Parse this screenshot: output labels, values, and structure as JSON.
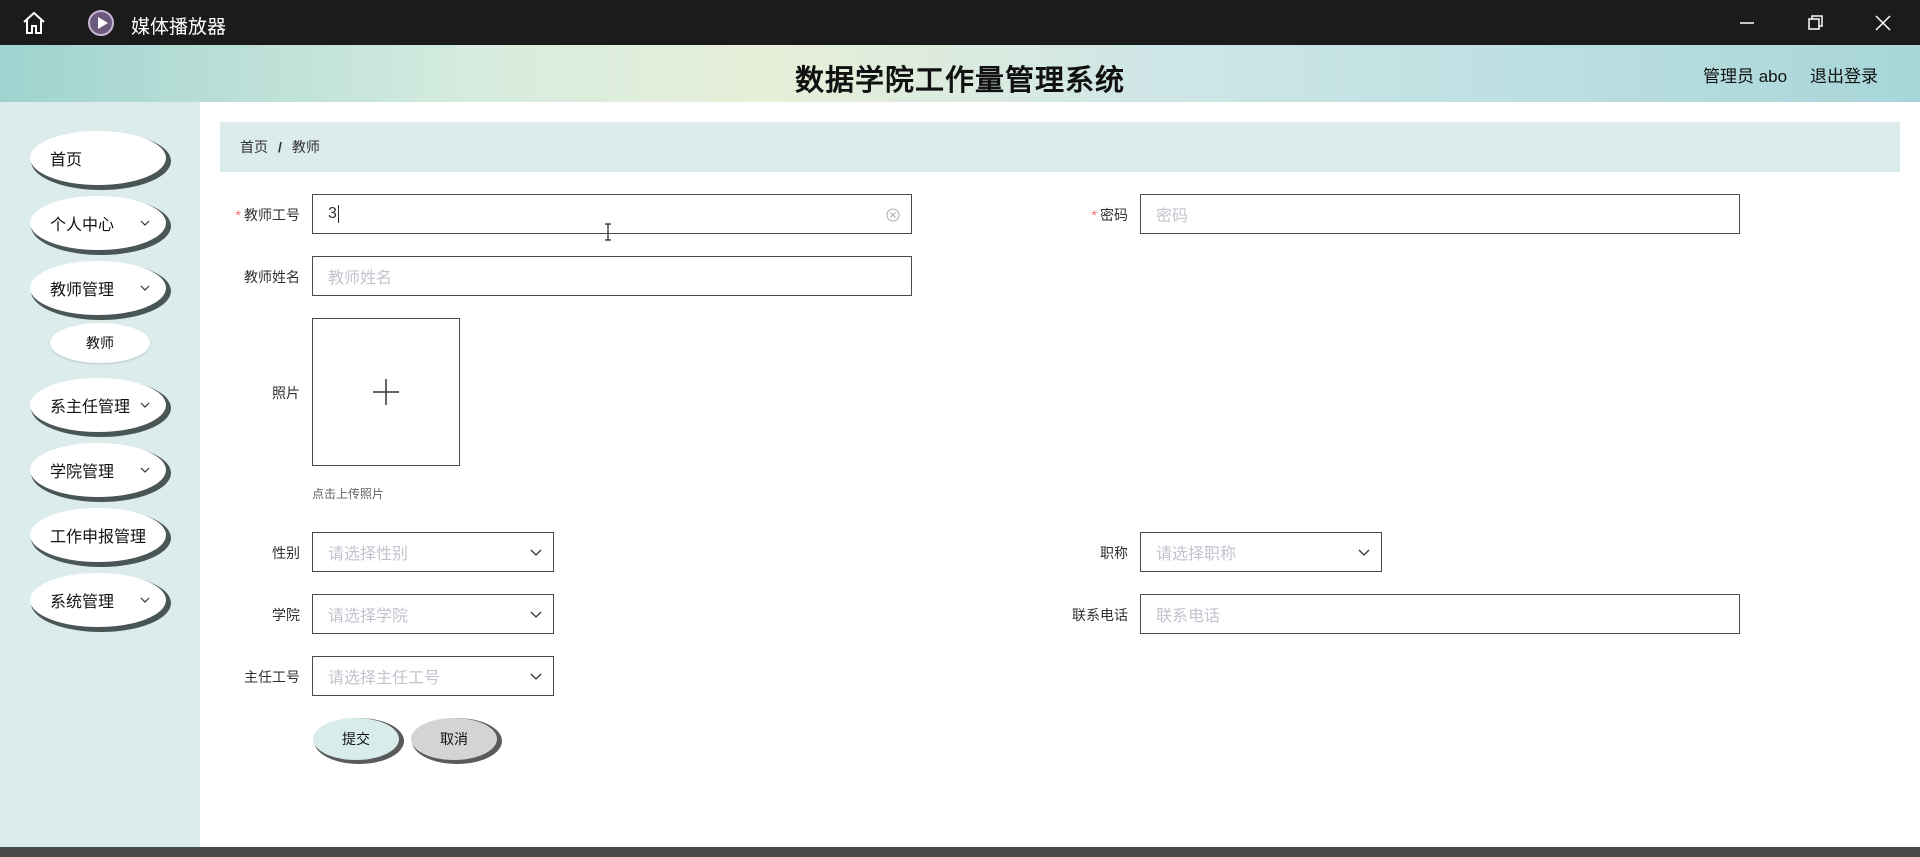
{
  "window": {
    "app_title": "媒体播放器",
    "icons": {
      "home": "home-icon",
      "app": "media-player-icon",
      "minimize": "minimize-icon",
      "maximize": "restore-icon",
      "close": "close-icon"
    }
  },
  "header": {
    "title": "数据学院工作量管理系统",
    "user": "管理员 abo",
    "logout": "退出登录"
  },
  "sidebar": {
    "items": [
      {
        "label": "首页"
      },
      {
        "label": "个人中心"
      },
      {
        "label": "教师管理"
      },
      {
        "label": "系主任管理"
      },
      {
        "label": "学院管理"
      },
      {
        "label": "工作申报管理"
      },
      {
        "label": "系统管理"
      }
    ],
    "submenu": {
      "label": "教师"
    }
  },
  "breadcrumb": {
    "home": "首页",
    "separator": "/",
    "current": "教师"
  },
  "form": {
    "teacher_id": {
      "label": "教师工号",
      "value": "3",
      "required": true
    },
    "password": {
      "label": "密码",
      "placeholder": "密码",
      "required": true
    },
    "teacher_name": {
      "label": "教师姓名",
      "placeholder": "教师姓名"
    },
    "photo": {
      "label": "照片",
      "hint": "点击上传照片"
    },
    "gender": {
      "label": "性别",
      "placeholder": "请选择性别"
    },
    "title": {
      "label": "职称",
      "placeholder": "请选择职称"
    },
    "college": {
      "label": "学院",
      "placeholder": "请选择学院"
    },
    "phone": {
      "label": "联系电话",
      "placeholder": "联系电话"
    },
    "director_id": {
      "label": "主任工号",
      "placeholder": "请选择主任工号"
    },
    "required_mark": "*",
    "submit": "提交",
    "cancel": "取消"
  },
  "colors": {
    "titlebar": "#1b1b1b",
    "sidebar_bg": "#dcebeb",
    "breadcrumb_bg": "#dcebeb",
    "required": "#f56c6c",
    "placeholder": "#c0c4cc"
  }
}
